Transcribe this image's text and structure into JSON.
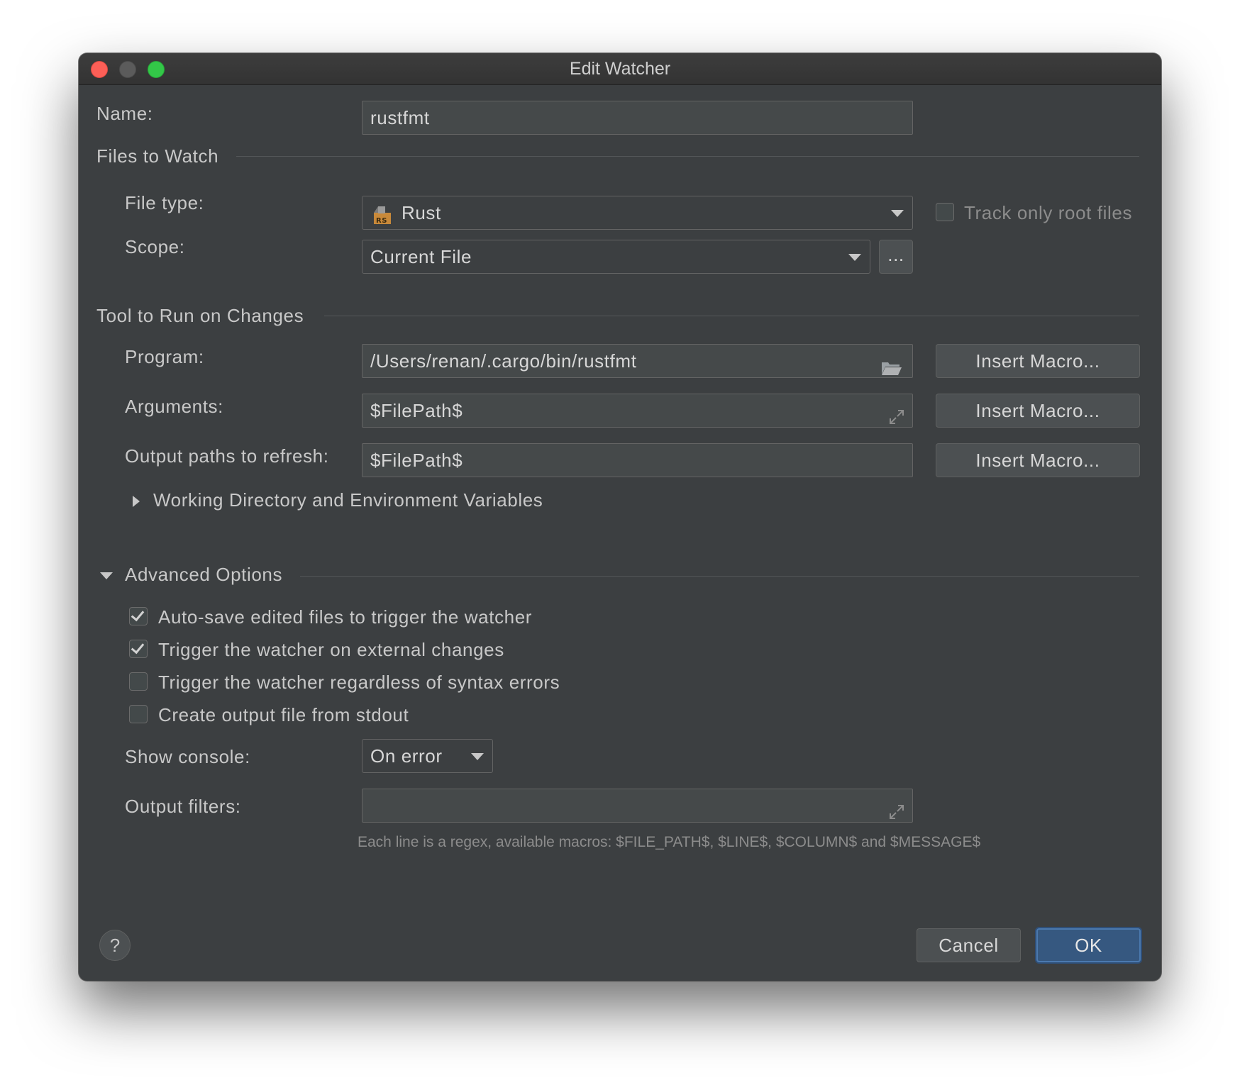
{
  "window": {
    "title": "Edit Watcher"
  },
  "name": {
    "label": "Name:",
    "value": "rustfmt"
  },
  "files_to_watch": {
    "title": "Files to Watch",
    "file_type_label": "File type:",
    "file_type_value": "Rust",
    "file_type_icon": "rust-file-icon",
    "track_root_label": "Track only root files",
    "track_root_checked": false,
    "scope_label": "Scope:",
    "scope_value": "Current File",
    "scope_more_label": "..."
  },
  "tool": {
    "title": "Tool to Run on Changes",
    "program_label": "Program:",
    "program_value": "/Users/renan/.cargo/bin/rustfmt",
    "arguments_label": "Arguments:",
    "arguments_value": "$FilePath$",
    "output_paths_label": "Output paths to refresh:",
    "output_paths_value": "$FilePath$",
    "insert_macro_label": "Insert Macro...",
    "working_dir_label": "Working Directory and Environment Variables"
  },
  "advanced": {
    "title": "Advanced Options",
    "options": [
      {
        "label": "Auto-save edited files to trigger the watcher",
        "checked": true
      },
      {
        "label": "Trigger the watcher on external changes",
        "checked": true
      },
      {
        "label": "Trigger the watcher regardless of syntax errors",
        "checked": false
      },
      {
        "label": "Create output file from stdout",
        "checked": false
      }
    ],
    "show_console_label": "Show console:",
    "show_console_value": "On error",
    "output_filters_label": "Output filters:",
    "output_filters_value": "",
    "hint": "Each line is a regex, available macros: $FILE_PATH$, $LINE$, $COLUMN$ and $MESSAGE$"
  },
  "footer": {
    "help_label": "?",
    "cancel_label": "Cancel",
    "ok_label": "OK"
  },
  "colors": {
    "background": "#3c3f41",
    "field": "#45494a",
    "default_button": "#365880",
    "text": "#c8c8c8"
  }
}
